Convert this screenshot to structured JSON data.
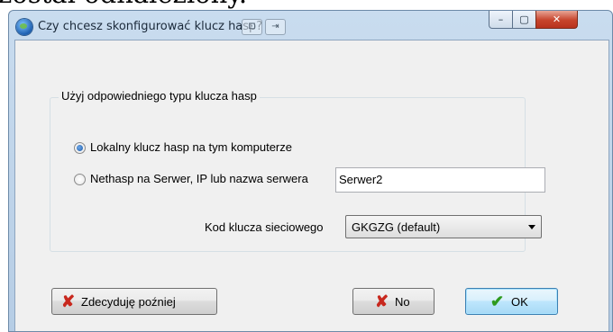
{
  "background_text": "został odnaleziony.",
  "window": {
    "title": "Czy chcesz skonfigurować klucz hasp?",
    "controls": {
      "minimize": "–",
      "maximize": "▢",
      "close": "✕"
    }
  },
  "group": {
    "label": "Użyj odpowiedniego typu klucza hasp",
    "options": [
      {
        "label": "Lokalny klucz hasp na tym komputerze",
        "checked": true
      },
      {
        "label": "Nethasp na Serwer, IP lub nazwa serwera",
        "checked": false
      }
    ],
    "server_value": "Serwer2",
    "network_key": {
      "label": "Kod klucza sieciowego",
      "selected": "GKGZG (default)"
    }
  },
  "buttons": {
    "later": "Zdecyduję poźniej",
    "no": "No",
    "ok": "OK"
  },
  "icons": {
    "x": "✘",
    "check": "✔"
  },
  "colors": {
    "x_icon": "#c8281e",
    "check_icon": "#2e9a1e",
    "close_button": "#c7442c"
  }
}
